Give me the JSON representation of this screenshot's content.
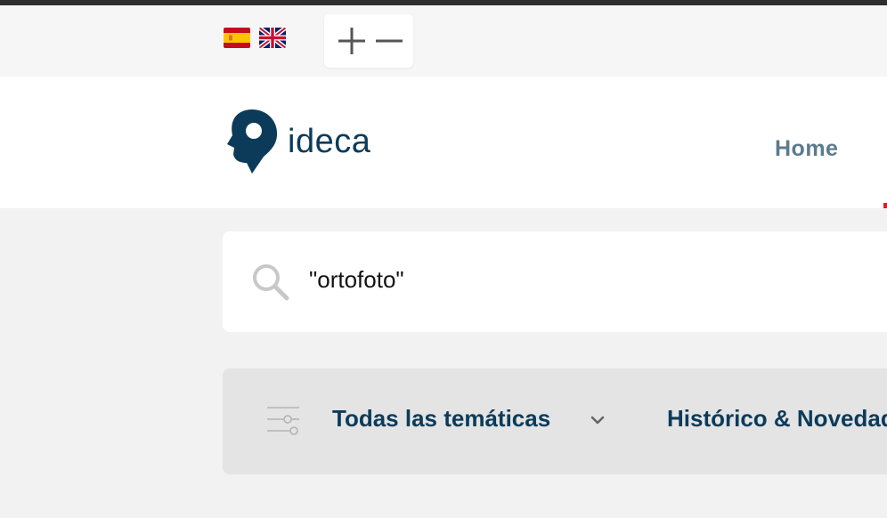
{
  "colors": {
    "brand": "#0c3b5a",
    "nav_text": "#5c7a8d",
    "accent_red": "#e31b23",
    "page_bg": "#f2f2f2"
  },
  "languages": [
    {
      "code": "es",
      "icon": "spain-flag-icon"
    },
    {
      "code": "en",
      "icon": "uk-flag-icon"
    }
  ],
  "zoom": {
    "increase_icon": "plus-icon",
    "decrease_icon": "minus-icon"
  },
  "header": {
    "logo_icon": "ideca-head-pin-logo",
    "logo_text": "ideca",
    "nav": {
      "home": "Home"
    }
  },
  "search": {
    "icon": "search-icon",
    "value": "\"ortofoto\""
  },
  "filters": {
    "icon": "sliders-icon",
    "tematicas": "Todas las temáticas",
    "tematicas_icon": "chevron-down-icon",
    "historico": "Histórico & Novedades"
  }
}
